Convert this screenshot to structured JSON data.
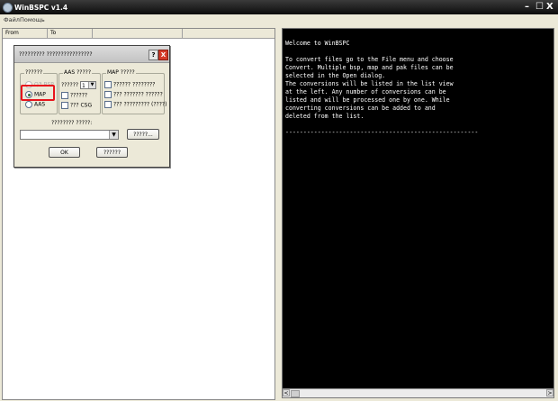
{
  "window": {
    "title": "WinBSPC v1.4",
    "minimize": "–",
    "maximize": "☐",
    "close": "X"
  },
  "menu": {
    "file": "Файл",
    "help": "Помощь"
  },
  "list": {
    "columns": [
      "From",
      "To"
    ]
  },
  "dialog": {
    "title": "????????? ????????????????",
    "help_button": "?",
    "close_button": "X",
    "format_group": {
      "label": "??????",
      "options": [
        "Q3 BSP",
        "MAP",
        "AAS"
      ],
      "selected": "MAP"
    },
    "aas_group": {
      "label": "AAS ?????",
      "spin_label": "??????",
      "spin_value": "1",
      "check_1": "??????",
      "check_2": "??? CSG"
    },
    "map_group": {
      "label": "MAP ?????",
      "check_1": "?????? ????????",
      "check_2": "??? ??????? ??????",
      "check_3": "??? ????????? (????)"
    },
    "output_label": "???????? ?????:",
    "combo_value": "",
    "browse_button": "?????...",
    "ok_button": "OK",
    "cancel_button": "??????"
  },
  "console": {
    "lines": [
      "Welcome to WinBSPC",
      "",
      "To convert files go to the File menu and choose",
      "Convert. Multiple bsp, map and pak files can be",
      "selected in the Open dialog.",
      "The conversions will be listed in the list view",
      "at the left. Any number of conversions can be",
      "listed and will be processed one by one. While",
      "converting conversions can be added to and",
      "deleted from the list.",
      "",
      "------------------------------------------------------"
    ]
  },
  "scroll": {
    "left": "<",
    "right": ">"
  }
}
